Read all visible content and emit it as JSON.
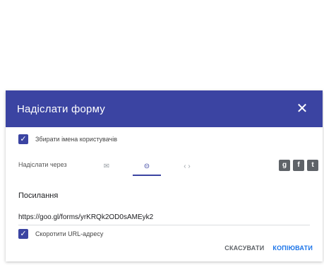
{
  "dialog": {
    "title": "Надіслати форму",
    "close_icon": "close-icon"
  },
  "collect_emails": {
    "checked": true,
    "label": "Збирати імена користувачів"
  },
  "send_via": {
    "label": "Надіслати через",
    "tabs": [
      {
        "icon": "email-icon",
        "glyph": "✉",
        "active": false
      },
      {
        "icon": "link-icon",
        "glyph": "⊝",
        "active": true
      },
      {
        "icon": "embed-icon",
        "glyph": "‹ ›",
        "active": false
      }
    ],
    "social": [
      {
        "icon": "google-plus-icon",
        "glyph": "g"
      },
      {
        "icon": "facebook-icon",
        "glyph": "f"
      },
      {
        "icon": "twitter-icon",
        "glyph": "t"
      }
    ]
  },
  "link": {
    "heading": "Посилання",
    "url": "https://goo.gl/forms/yrKRQk2OD0sAMEyk2"
  },
  "shorten": {
    "checked": true,
    "label": "Скоротити URL-адресу"
  },
  "actions": {
    "cancel": "СКАСУВАТИ",
    "copy": "КОПІЮВАТИ"
  },
  "colors": {
    "header": "#3b44a2",
    "accent": "#1a73e8"
  }
}
